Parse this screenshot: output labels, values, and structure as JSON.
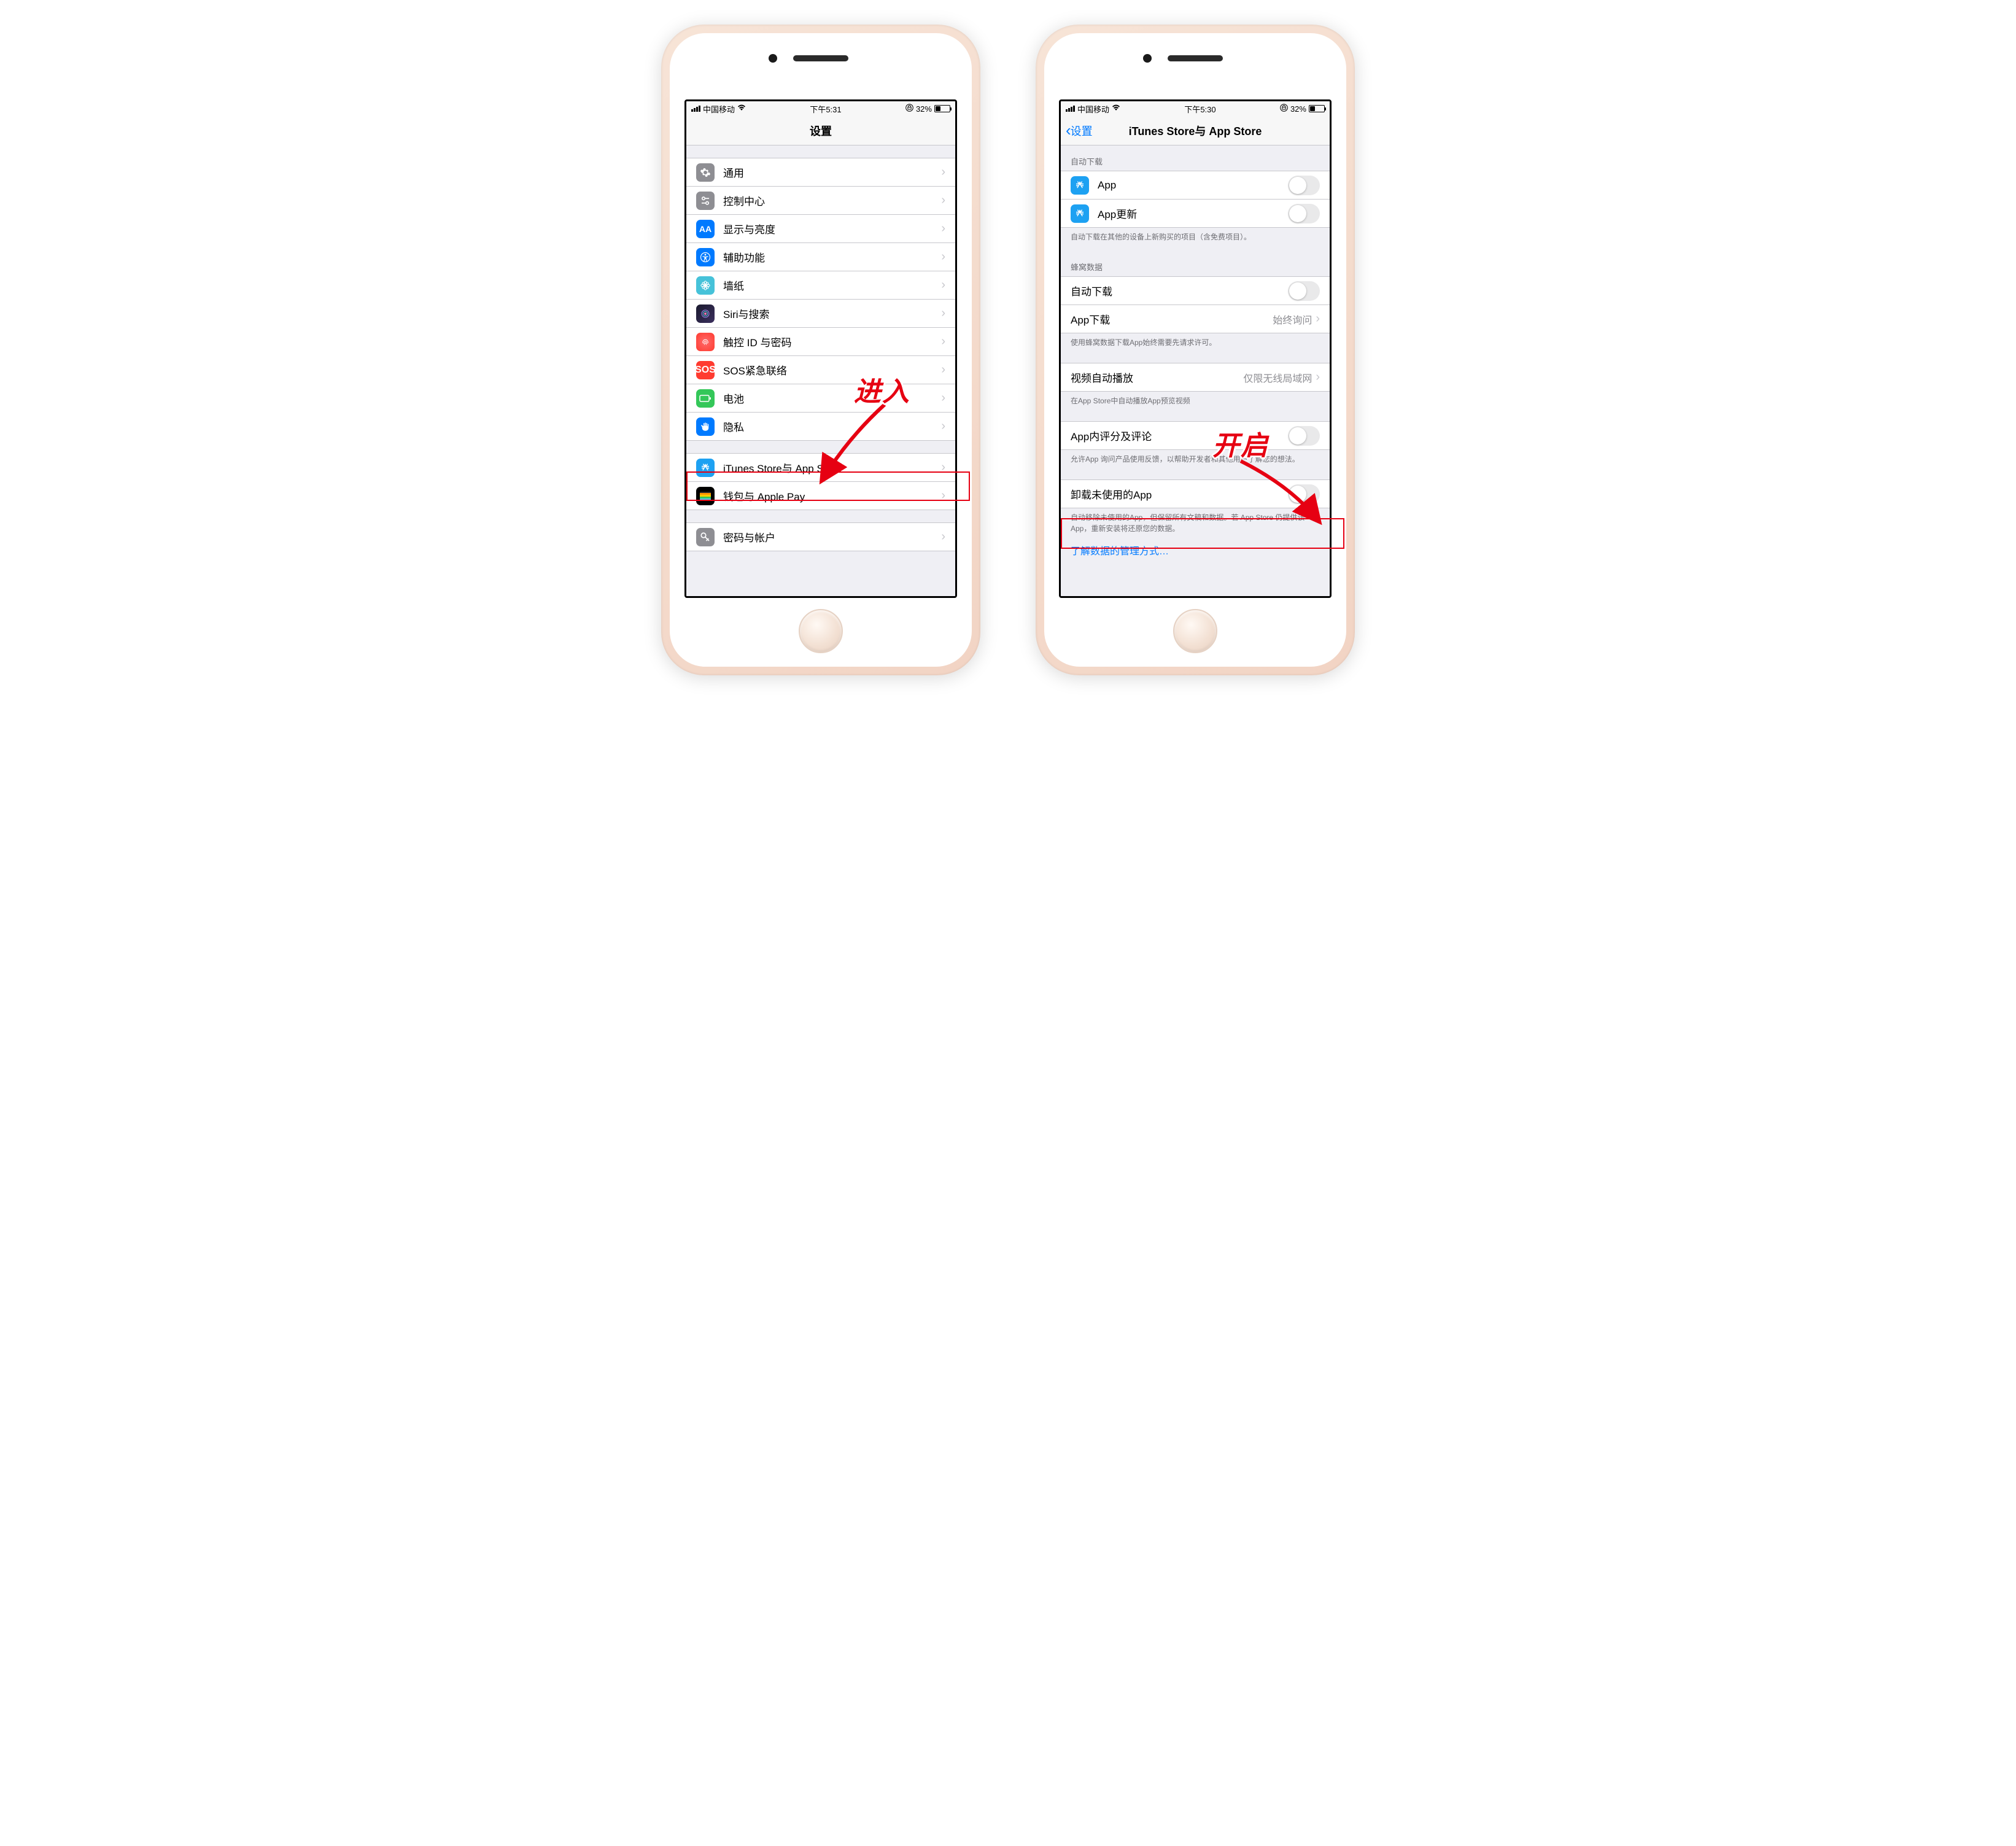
{
  "phone1": {
    "status": {
      "carrier": "中国移动",
      "time": "下午5:31",
      "battery_pct": "32%"
    },
    "nav": {
      "title": "设置"
    },
    "groups": {
      "g1": {
        "general": "通用",
        "controlcenter": "控制中心",
        "display": "显示与亮度",
        "accessibility": "辅助功能",
        "wallpaper": "墙纸",
        "siri": "Siri与搜索",
        "touchid": "触控 ID 与密码",
        "sos": "SOS紧急联络",
        "battery": "电池",
        "privacy": "隐私"
      },
      "g2": {
        "appstore": "iTunes Store与 App Store",
        "wallet": "钱包与 Apple Pay"
      },
      "g3": {
        "passwords": "密码与帐户"
      }
    },
    "annotation": {
      "label": "进入"
    }
  },
  "phone2": {
    "status": {
      "carrier": "中国移动",
      "time": "下午5:30",
      "battery_pct": "32%"
    },
    "nav": {
      "back": "设置",
      "title": "iTunes Store与 App Store"
    },
    "sections": {
      "autodl_header": "自动下载",
      "app": "App",
      "app_update": "App更新",
      "autodl_footer": "自动下载在其他的设备上新购买的项目（含免费项目）。",
      "cellular_header": "蜂窝数据",
      "autodl2": "自动下载",
      "appdl": "App下载",
      "appdl_detail": "始终询问",
      "cellular_footer": "使用蜂窝数据下载App始终需要先请求许可。",
      "video": "视频自动播放",
      "video_detail": "仅限无线局域网",
      "video_footer": "在App Store中自动播放App预览视频",
      "rating": "App内评分及评论",
      "rating_footer": "允许App 询问产品使用反馈，以帮助开发者和其他用户了解您的想法。",
      "offload": "卸载未使用的App",
      "offload_footer": "自动移除未使用的App，但保留所有文稿和数据。若 App Store 仍提供该App，重新安装将还原您的数据。",
      "learn_link": "了解数据的管理方式…"
    },
    "annotation": {
      "label": "开启"
    }
  }
}
